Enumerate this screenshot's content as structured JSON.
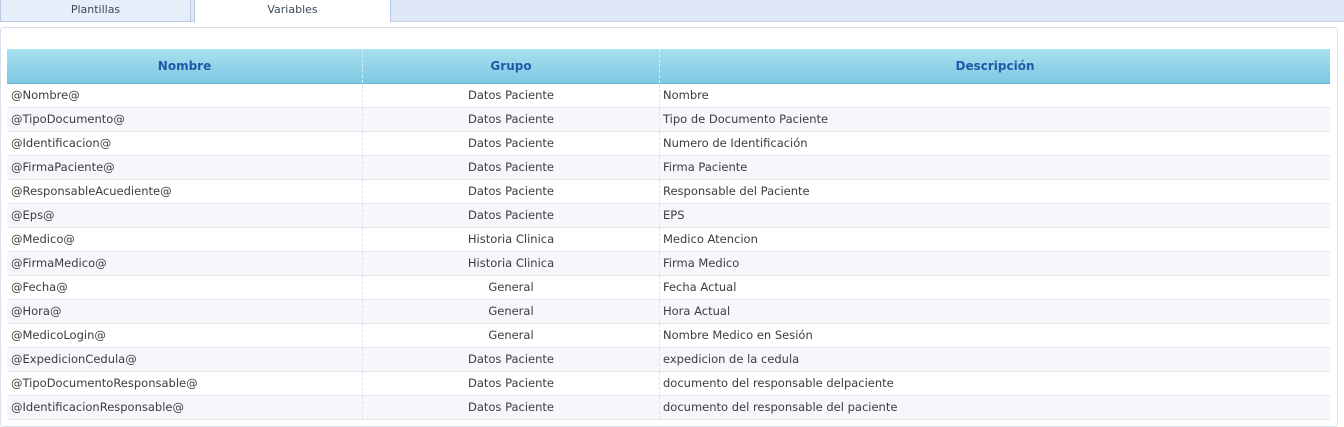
{
  "tabs": [
    {
      "label": "Plantillas",
      "active": false
    },
    {
      "label": "Variables",
      "active": true
    }
  ],
  "table": {
    "columns": [
      "Nombre",
      "Grupo",
      "Descripción"
    ],
    "rows": [
      [
        "@Nombre@",
        "Datos Paciente",
        "Nombre"
      ],
      [
        "@TipoDocumento@",
        "Datos Paciente",
        "Tipo de Documento Paciente"
      ],
      [
        "@Identificacion@",
        "Datos Paciente",
        "Numero de Identificación"
      ],
      [
        "@FirmaPaciente@",
        "Datos Paciente",
        "Firma Paciente"
      ],
      [
        "@ResponsableAcuediente@",
        "Datos Paciente",
        "Responsable del Paciente"
      ],
      [
        "@Eps@",
        "Datos Paciente",
        "EPS"
      ],
      [
        "@Medico@",
        "Historia Clinica",
        "Medico Atencion"
      ],
      [
        "@FirmaMedico@",
        "Historia Clinica",
        "Firma Medico"
      ],
      [
        "@Fecha@",
        "General",
        "Fecha Actual"
      ],
      [
        "@Hora@",
        "General",
        "Hora Actual"
      ],
      [
        "@MedicoLogin@",
        "General",
        "Nombre Medico en Sesión"
      ],
      [
        "@ExpedicionCedula@",
        "Datos Paciente",
        "expedicion de la cedula"
      ],
      [
        "@TipoDocumentoResponsable@",
        "Datos Paciente",
        "documento del responsable delpaciente"
      ],
      [
        "@IdentificacionResponsable@",
        "Datos Paciente",
        "documento del responsable del paciente"
      ]
    ]
  },
  "colors": {
    "header_gradient_top": "#a8e0f0",
    "header_gradient_bottom": "#7cc9e2",
    "header_text": "#1e5aa8",
    "tabbar_bg": "#dfe8f6"
  }
}
